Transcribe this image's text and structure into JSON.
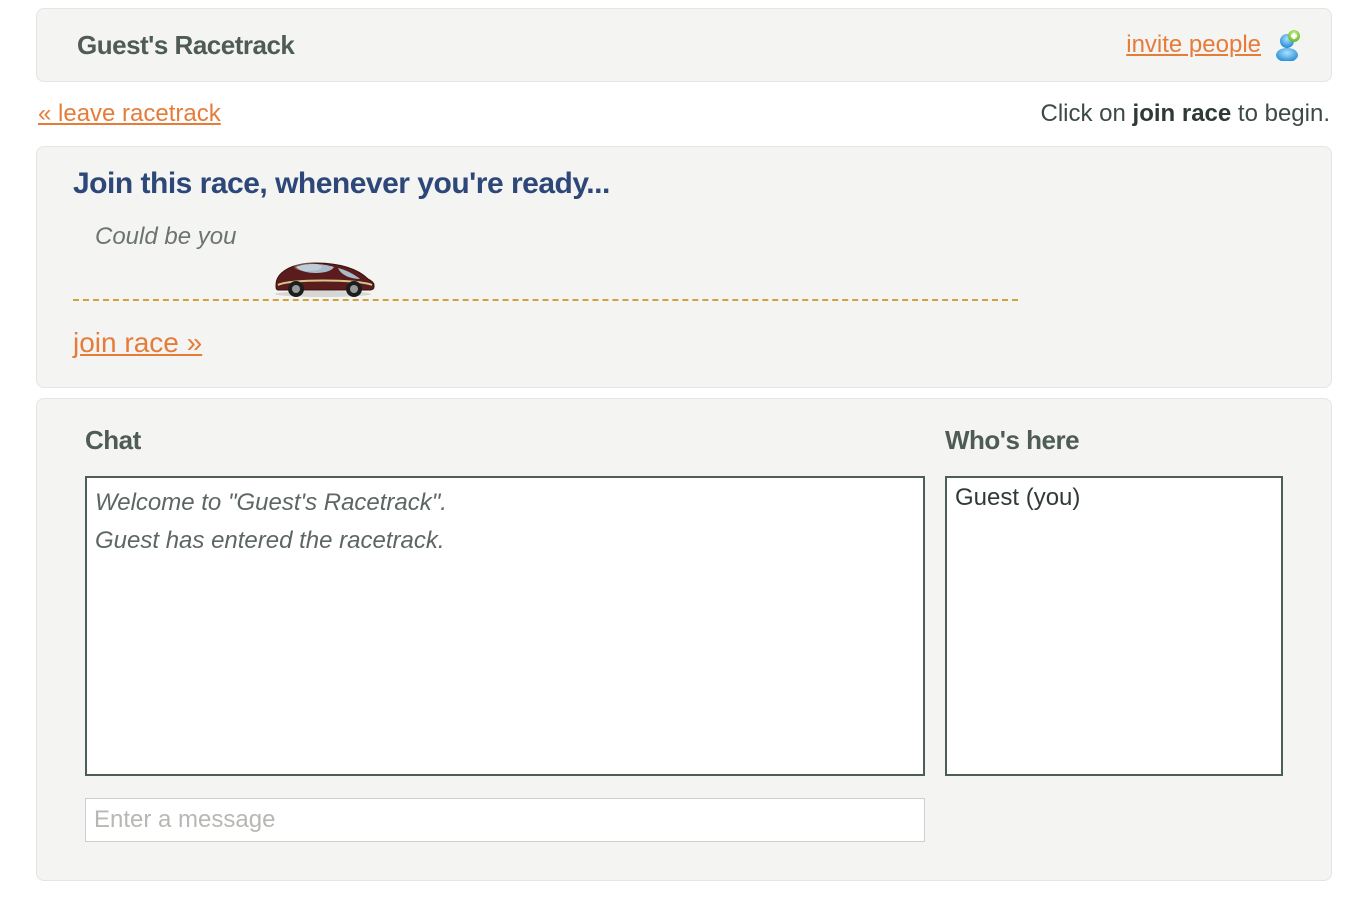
{
  "header": {
    "title": "Guest's Racetrack",
    "invite_label": "invite people"
  },
  "nav": {
    "leave_label": "« leave racetrack",
    "hint_prefix": "Click on ",
    "hint_bold": "join race",
    "hint_suffix": " to begin."
  },
  "race": {
    "heading": "Join this race, whenever you're ready...",
    "placeholder_name": "Could be you",
    "join_label": "join race »"
  },
  "chat": {
    "heading": "Chat",
    "messages": [
      "Welcome to \"Guest's Racetrack\".",
      "Guest has entered the racetrack."
    ],
    "input_placeholder": "Enter a message"
  },
  "who": {
    "heading": "Who's here",
    "people": [
      "Guest (you)"
    ]
  },
  "colors": {
    "link": "#e57c3a",
    "heading_blue": "#2d4778",
    "box_border": "#4b5e58",
    "dash": "#d0a23f"
  }
}
